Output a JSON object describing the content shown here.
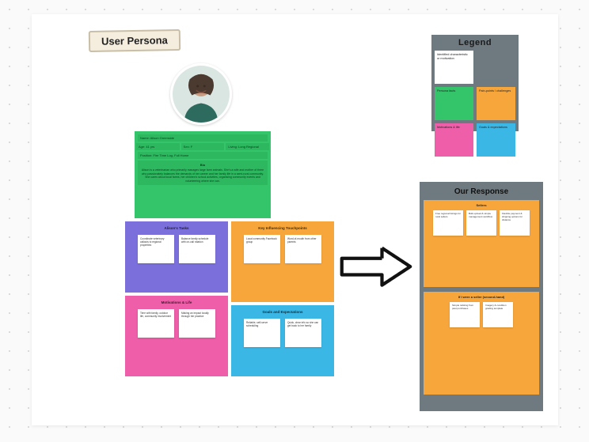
{
  "title": "User Persona",
  "avatar": {
    "caption": "Persona photo"
  },
  "bio": {
    "name_label": "Name: Alison Greenside",
    "age": "Age: 41 yrs",
    "gender": "Sex: F",
    "location": "Living: Long Regional",
    "position": "Position: Fire Time Log, Full Home",
    "bio_header": "Bio",
    "bio_text": "Alison is a veterinarian who primarily manages large farm animals. She's a wife and mother of three who passionately balances the demands of her career and her family life in a semi-rural community. She cares about local farms, her children's school activities, organising community events and volunteering where she can."
  },
  "quadrants": {
    "challenges": {
      "title": "Alison's Tasks",
      "notes": [
        "Coordinate veterinary callouts to regional properties",
        "Balance family schedule with on-call rotation"
      ]
    },
    "influences": {
      "title": "Key Influencing Touchpoints",
      "notes": [
        "Local community Facebook group",
        "Word-of-mouth from other parents"
      ]
    },
    "motivations": {
      "title": "Motivations & Life",
      "notes": [
        "Time with family, outdoor life, community involvement",
        "Making an impact locally through her practice"
      ]
    },
    "goals": {
      "title": "Goals and Expectations",
      "notes": [
        "Reliable, self-serve scheduling",
        "Quick, clear info so she can get back to her family"
      ]
    }
  },
  "legend": {
    "title": "Legend",
    "items": [
      {
        "label": "Identified characteristic or motivation",
        "color": "white"
      },
      {
        "label": "",
        "color": "blank"
      },
      {
        "label": "Persona facts",
        "color": "green"
      },
      {
        "label": "Pain-points / challenges",
        "color": "orange"
      },
      {
        "label": "Motivations & life",
        "color": "pink"
      },
      {
        "label": "Goals & expectations",
        "color": "blue"
      }
    ]
  },
  "response": {
    "title": "Our Response",
    "block1": {
      "subtitle": "Sellers",
      "notes": [
        "Free regional listings for rural sellers",
        "Bulk upload & simple management workflow",
        "Flexible payment & shipping options for distance"
      ]
    },
    "block2": {
      "subtitle": "If I were a seller (second-hand)",
      "notes": [
        "Simple relisting from past purchases",
        "Imagery & condition grading template"
      ]
    }
  }
}
